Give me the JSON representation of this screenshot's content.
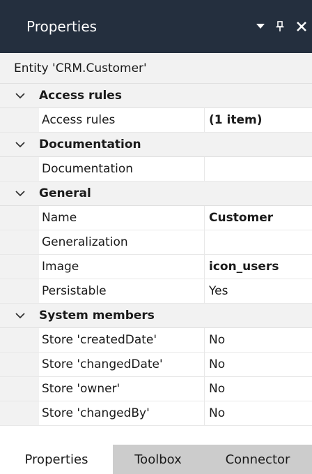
{
  "panel": {
    "title": "Properties",
    "entity_label": "Entity 'CRM.Customer'"
  },
  "categories": [
    {
      "label": "Access rules",
      "rows": [
        {
          "name": "Access rules",
          "value": "(1 item)",
          "bold": true
        }
      ]
    },
    {
      "label": "Documentation",
      "rows": [
        {
          "name": "Documentation",
          "value": "",
          "bold": false
        }
      ]
    },
    {
      "label": "General",
      "rows": [
        {
          "name": "Name",
          "value": "Customer",
          "bold": true
        },
        {
          "name": "Generalization",
          "value": "",
          "bold": false
        },
        {
          "name": "Image",
          "value": "icon_users",
          "bold": true
        },
        {
          "name": "Persistable",
          "value": "Yes",
          "bold": false
        }
      ]
    },
    {
      "label": "System members",
      "rows": [
        {
          "name": "Store 'createdDate'",
          "value": "No",
          "bold": false
        },
        {
          "name": "Store 'changedDate'",
          "value": "No",
          "bold": false
        },
        {
          "name": "Store 'owner'",
          "value": "No",
          "bold": false
        },
        {
          "name": "Store 'changedBy'",
          "value": "No",
          "bold": false
        }
      ]
    }
  ],
  "tabs": [
    {
      "label": "Properties",
      "active": true
    },
    {
      "label": "Toolbox",
      "active": false
    },
    {
      "label": "Connector",
      "active": false
    }
  ],
  "colors": {
    "titlebar_bg": "#242f3e",
    "category_bg": "#f2f2f2",
    "tabstrip_bg": "#cccccc"
  }
}
